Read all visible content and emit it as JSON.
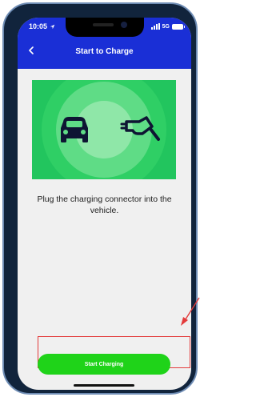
{
  "status_bar": {
    "time": "10:05",
    "network": "5G"
  },
  "header": {
    "title": "Start to Charge",
    "back_icon": "chevron-left-icon"
  },
  "hero": {
    "icons": [
      "car-icon",
      "charging-plug-icon"
    ]
  },
  "instruction": "Plug the charging connector into the vehicle.",
  "actions": {
    "start_label": "Start Charging"
  },
  "colors": {
    "header": "#1a2fd6",
    "hero": "#22c55e",
    "button": "#1fd319",
    "highlight": "#e33b3b"
  }
}
